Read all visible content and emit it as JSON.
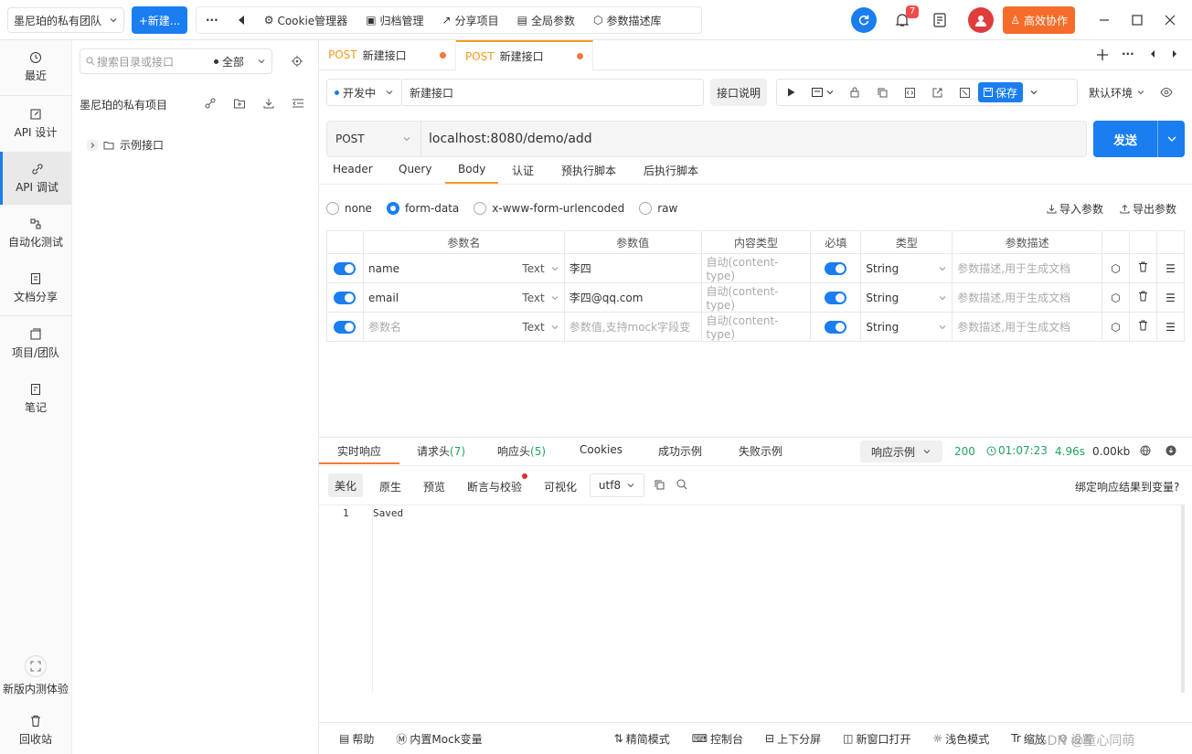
{
  "header": {
    "team": "墨尼珀的私有团队",
    "new_label": "+新建...",
    "more": "···",
    "tools": [
      "Cookie管理器",
      "归档管理",
      "分享项目",
      "全局参数",
      "参数描述库"
    ],
    "notify_count": "7",
    "collab": "高效协作"
  },
  "rail": {
    "items": [
      {
        "label": "最近",
        "icon": "clock-icon"
      },
      {
        "label": "API 设计",
        "icon": "edit-icon"
      },
      {
        "label": "API 调试",
        "icon": "link-icon"
      },
      {
        "label": "自动化测试",
        "icon": "flow-icon"
      },
      {
        "label": "文档分享",
        "icon": "doc-icon"
      },
      {
        "label": "项目/团队",
        "icon": "folders-icon"
      },
      {
        "label": "笔记",
        "icon": "note-icon"
      }
    ],
    "beta": "新版内测体验",
    "trash": "回收站"
  },
  "tree": {
    "search_placeholder": "搜索目录或接口",
    "filter": "全部",
    "project": "墨尼珀的私有项目",
    "folder": "示例接口"
  },
  "tabs": [
    {
      "method": "POST",
      "name": "新建接口"
    },
    {
      "method": "POST",
      "name": "新建接口"
    }
  ],
  "request": {
    "status": "开发中",
    "name": "新建接口",
    "doc_btn": "接口说明",
    "save": "保存",
    "env": "默认环境",
    "method": "POST",
    "url": "localhost:8080/demo/add",
    "send": "发送",
    "sub_tabs": [
      "Header",
      "Query",
      "Body",
      "认证",
      "预执行脚本",
      "后执行脚本"
    ],
    "body_types": [
      "none",
      "form-data",
      "x-www-form-urlencoded",
      "raw"
    ],
    "import": "导入参数",
    "export": "导出参数"
  },
  "params": {
    "headers": [
      "参数名",
      "参数值",
      "内容类型",
      "必填",
      "类型",
      "参数描述"
    ],
    "rows": [
      {
        "name": "name",
        "ftype": "Text",
        "value": "李四",
        "content": "自动(content-type)",
        "type": "String",
        "desc": "参数描述,用于生成文档"
      },
      {
        "name": "email",
        "ftype": "Text",
        "value": "李四@qq.com",
        "content": "自动(content-type)",
        "type": "String",
        "desc": "参数描述,用于生成文档"
      },
      {
        "name": "参数名",
        "ftype": "Text",
        "value": "参数值,支持mock字段变",
        "content": "自动(content-type)",
        "type": "String",
        "desc": "参数描述,用于生成文档"
      }
    ]
  },
  "response": {
    "tabs": [
      "实时响应",
      "请求头",
      "响应头",
      "Cookies",
      "成功示例",
      "失败示例"
    ],
    "req_count": "(7)",
    "resp_count": "(5)",
    "example": "响应示例",
    "status": "200",
    "time": "01:07:23",
    "duration": "4.96s",
    "size": "0.00kb",
    "views": [
      "美化",
      "原生",
      "预览",
      "断言与校验",
      "可视化"
    ],
    "encoding": "utf8",
    "bind": "绑定响应结果到变量?",
    "line": "1",
    "body": "Saved"
  },
  "footer": {
    "items": [
      "帮助",
      "内置Mock变量",
      "精简模式",
      "控制台",
      "上下分屏",
      "新窗口打开",
      "浅色模式",
      "缩放",
      "设置"
    ],
    "watermark": "CSDN @童心同萌"
  },
  "colors": {
    "accent": "#1a7df0",
    "orange": "#f56c2a",
    "method": "#f59a23",
    "ok": "#20a35a"
  }
}
